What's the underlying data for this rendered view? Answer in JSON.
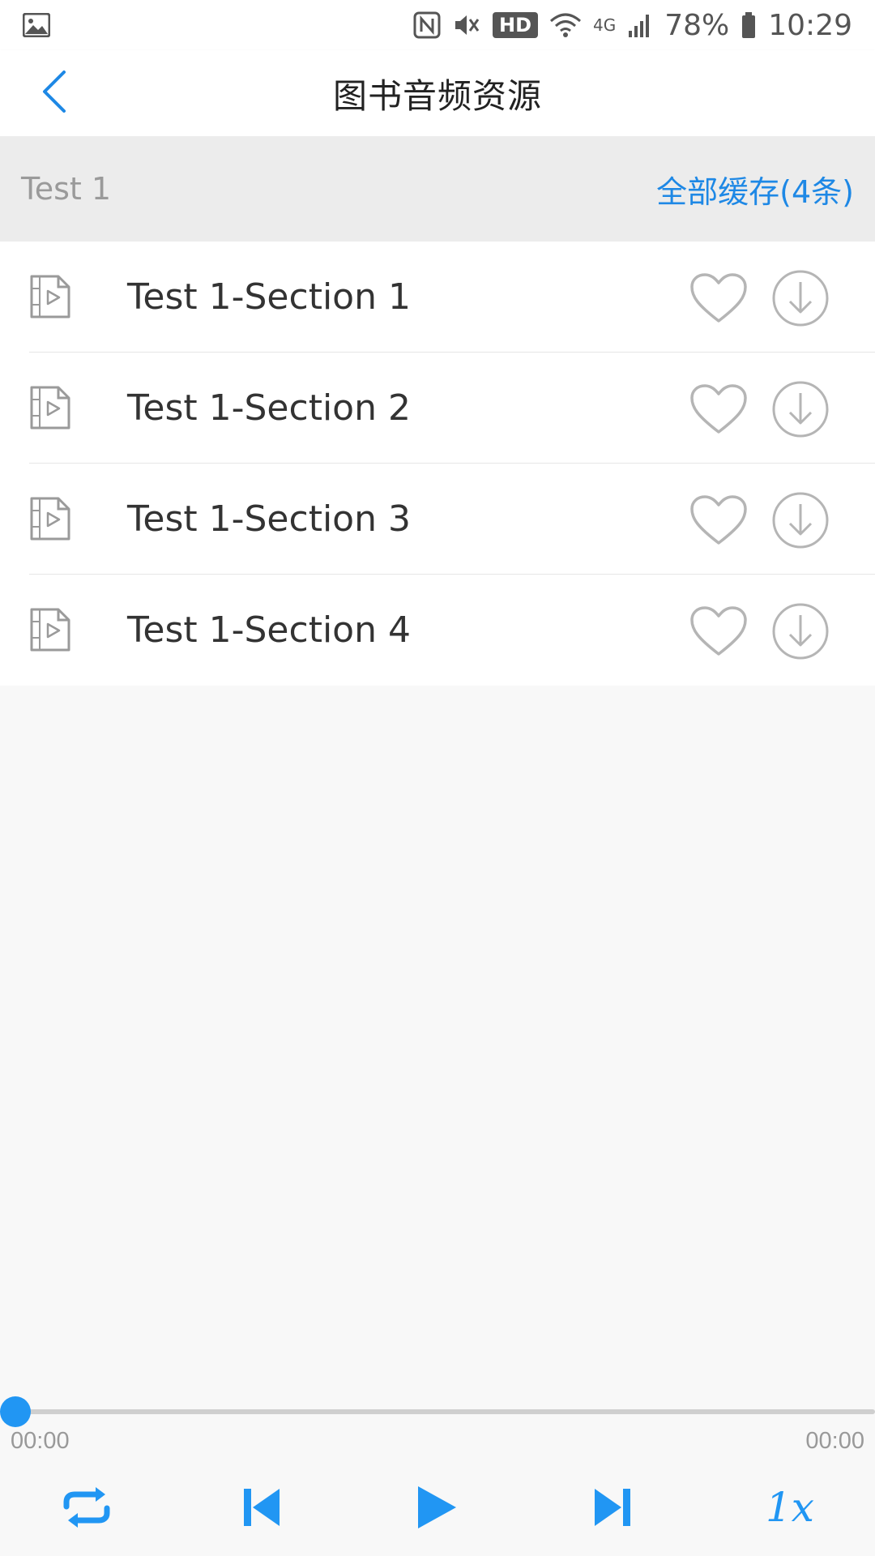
{
  "status_bar": {
    "hd": "HD",
    "network": "4G",
    "battery": "78%",
    "time": "10:29"
  },
  "header": {
    "title": "图书音频资源",
    "back_icon": "chevron-left-icon"
  },
  "section": {
    "name": "Test 1",
    "cache_all_label": "全部缓存(4条)"
  },
  "tracks": [
    {
      "title": "Test 1-Section 1"
    },
    {
      "title": "Test 1-Section 2"
    },
    {
      "title": "Test 1-Section 3"
    },
    {
      "title": "Test 1-Section 4"
    }
  ],
  "player": {
    "current_time": "00:00",
    "total_time": "00:00",
    "progress": 0,
    "speed_label": "1x"
  },
  "colors": {
    "accent": "#2196f3",
    "link": "#1e88e5",
    "icon_gray": "#b5b5b5"
  }
}
